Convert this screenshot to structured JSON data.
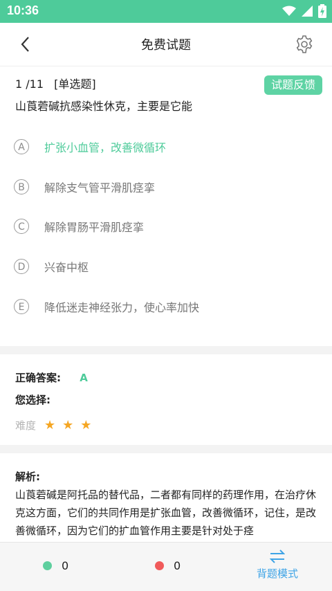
{
  "status_bar": {
    "time": "10:36"
  },
  "header": {
    "title": "免费试题",
    "back_icon": "chevron-left-icon",
    "settings_icon": "gear-icon"
  },
  "question": {
    "index": "1 /11",
    "type": "[单选题]",
    "text": "山莨菪碱抗感染性休克，主要是它能",
    "feedback_label": "试题反馈",
    "options": [
      {
        "letter": "A",
        "text": "扩张小血管，改善微循环"
      },
      {
        "letter": "B",
        "text": "解除支气管平滑肌痉挛"
      },
      {
        "letter": "C",
        "text": "解除胃肠平滑肌痉挛"
      },
      {
        "letter": "D",
        "text": "兴奋中枢"
      },
      {
        "letter": "E",
        "text": "降低迷走神经张力，使心率加快"
      }
    ],
    "correct_option": "A"
  },
  "answer": {
    "correct_label": "正确答案:",
    "correct_value": "A",
    "your_choice_label": "您选择:",
    "difficulty_label": "难度",
    "difficulty_stars": 3,
    "difficulty_stars_text": "★★★"
  },
  "analysis": {
    "title": "解析:",
    "text": "山莨菪碱是阿托品的替代品，二者都有同样的药理作用，在治疗休克这方面，它们的共同作用是扩张血管，改善微循环，记住，是改善微循环，因为它们的扩血管作用主要是针对处于痉"
  },
  "bottom_bar": {
    "correct_count": "0",
    "wrong_count": "0",
    "mode_label": "背题模式",
    "mode_icon": "swap-icon"
  },
  "colors": {
    "accent": "#4ecb9a",
    "wrong": "#f05a5a",
    "star": "#f5a623",
    "mode": "#3fa4e6"
  }
}
